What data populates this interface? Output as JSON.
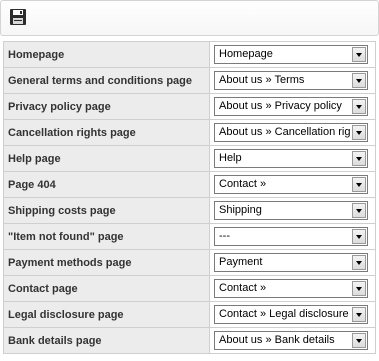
{
  "toolbar": {
    "save_icon": "floppy-disk-save-icon"
  },
  "rows": [
    {
      "label": "Homepage",
      "value": "Homepage"
    },
    {
      "label": "General terms and conditions page",
      "value": "About us » Terms"
    },
    {
      "label": "Privacy policy page",
      "value": "About us » Privacy policy"
    },
    {
      "label": "Cancellation rights page",
      "value": "About us » Cancellation rig"
    },
    {
      "label": "Help page",
      "value": "Help"
    },
    {
      "label": "Page 404",
      "value": "Contact »"
    },
    {
      "label": "Shipping costs page",
      "value": "Shipping"
    },
    {
      "label": "\"Item not found\" page",
      "value": "---"
    },
    {
      "label": "Payment methods page",
      "value": "Payment"
    },
    {
      "label": "Contact page",
      "value": "Contact »"
    },
    {
      "label": "Legal disclosure page",
      "value": "Contact » Legal disclosure"
    },
    {
      "label": "Bank details page",
      "value": "About us » Bank details"
    }
  ]
}
